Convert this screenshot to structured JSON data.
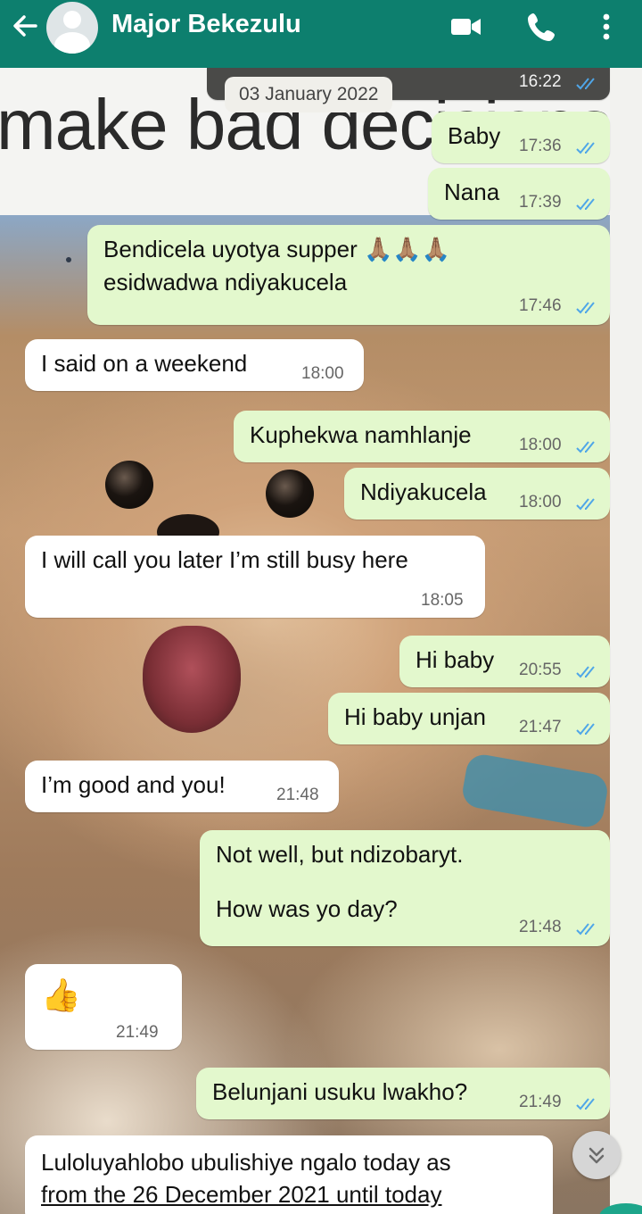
{
  "header": {
    "contact_name": "Major Bekezulu",
    "back_icon": "arrow-left-icon",
    "avatar_icon": "default-avatar-icon",
    "video_icon": "video-call-icon",
    "call_icon": "phone-icon",
    "menu_icon": "more-vert-icon"
  },
  "wallpaper": {
    "text": "make bad decisions"
  },
  "date_chip": "03 January 2022",
  "messages": [
    {
      "dir": "out",
      "text": "",
      "time": "16:22",
      "ticks": "read"
    },
    {
      "dir": "out",
      "text": "Baby",
      "time": "17:36",
      "ticks": "read"
    },
    {
      "dir": "out",
      "text": "Nana",
      "time": "17:39",
      "ticks": "read"
    },
    {
      "dir": "out",
      "line1": "Bendicela uyotya supper 🙏🏽🙏🏽🙏🏽",
      "line2": "esidwadwa ndiyakucela",
      "time": "17:46",
      "ticks": "read"
    },
    {
      "dir": "in",
      "text": "I said on a weekend",
      "time": "18:00"
    },
    {
      "dir": "out",
      "text": "Kuphekwa namhlanje",
      "time": "18:00",
      "ticks": "read"
    },
    {
      "dir": "out",
      "text": "Ndiyakucela",
      "time": "18:00",
      "ticks": "read"
    },
    {
      "dir": "in",
      "text": "I will call you later I’m still busy here",
      "time": "18:05"
    },
    {
      "dir": "out",
      "text": "Hi baby",
      "time": "20:55",
      "ticks": "read"
    },
    {
      "dir": "out",
      "text": "Hi baby unjan",
      "time": "21:47",
      "ticks": "read"
    },
    {
      "dir": "in",
      "text": "I’m good and you!",
      "time": "21:48"
    },
    {
      "dir": "out",
      "line1": "Not well, but ndizobaryt.",
      "line2": "How was yo day?",
      "time": "21:48",
      "ticks": "read"
    },
    {
      "dir": "in",
      "text": "👍",
      "time": "21:49"
    },
    {
      "dir": "out",
      "text": "Belunjani usuku lwakho?",
      "time": "21:49",
      "ticks": "read"
    },
    {
      "dir": "in",
      "line1": "Luloluyahlobo ubulishiye ngalo today as",
      "line2": "from the 26 December 2021 until today"
    }
  ],
  "scroll_button_icon": "double-chevron-down-icon",
  "colors": {
    "header": "#0d7f6e",
    "outgoing_bubble": "#e3f8cd",
    "incoming_bubble": "#ffffff",
    "read_ticks": "#4fa6e8"
  }
}
